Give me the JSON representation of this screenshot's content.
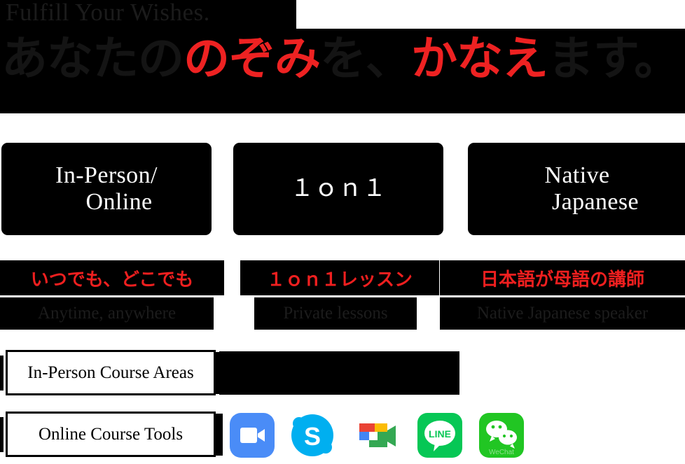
{
  "hero": {
    "english_tagline": "Fulfill Your Wishes.",
    "japanese_segments": [
      {
        "text": "あなたの",
        "color": "#141414"
      },
      {
        "text": "のぞみ",
        "color": "#ee2222"
      },
      {
        "text": "を、",
        "color": "#141414"
      },
      {
        "text": "かなえ",
        "color": "#ee2222"
      },
      {
        "text": "ます。",
        "color": "#141414"
      }
    ],
    "japanese_full": "あなたののぞみを、かなえます。"
  },
  "features": [
    {
      "card_line1": "In-Person/",
      "card_line2": "Online",
      "japanese_caption": "いつでも、どこでも",
      "english_caption": "Anytime, anywhere"
    },
    {
      "card_line1": "１ｏｎ１",
      "card_line2": "",
      "japanese_caption": "１ｏｎ１レッスン",
      "english_caption": "Private lessons"
    },
    {
      "card_line1": "Native",
      "card_line2": "Japanese",
      "japanese_caption": "日本語が母語の講師",
      "english_caption": "Native Japanese speaker"
    }
  ],
  "bottom": {
    "areas_label": "In-Person Course Areas",
    "tools_label": "Online Course Tools",
    "tools": [
      {
        "name": "zoom-icon",
        "label": "Zoom",
        "color": "#4a8cf7"
      },
      {
        "name": "skype-icon",
        "label": "Skype",
        "color": "#00aff0"
      },
      {
        "name": "google-meet-icon",
        "label": "Google Meet",
        "color": "#00ac47"
      },
      {
        "name": "line-icon",
        "label": "LINE",
        "color": "#06c755"
      },
      {
        "name": "wechat-icon",
        "label": "WeChat",
        "color": "#21c623"
      }
    ]
  },
  "colors": {
    "accent_red": "#ee2222",
    "ink_black": "#000000",
    "paper_white": "#ffffff",
    "muted_on_black": "#1c1c1c"
  }
}
